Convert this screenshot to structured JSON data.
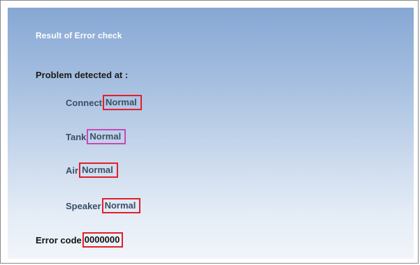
{
  "window": {
    "title": "Result of Error check"
  },
  "problem_heading": "Problem detected at :",
  "checks": [
    {
      "label": "Connect",
      "status": "Normal"
    },
    {
      "label": "Tank",
      "status": "Normal"
    },
    {
      "label": "Air",
      "status": "Normal"
    },
    {
      "label": "Speaker",
      "status": "Normal"
    }
  ],
  "error_code": {
    "label": "Error code",
    "value": "0000000"
  },
  "colors": {
    "highlight_box": "#e0202a",
    "highlight_box_alt": "#c649b9",
    "panel_top": "#86a7d4",
    "panel_bottom": "#f1f5fa",
    "title_text": "#ffffff"
  }
}
